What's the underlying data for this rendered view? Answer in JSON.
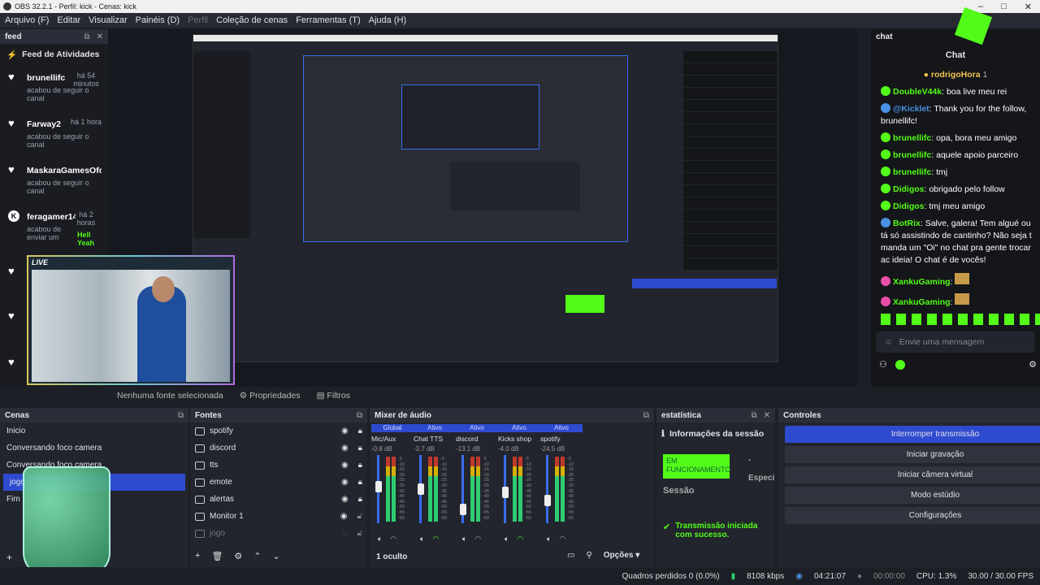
{
  "window": {
    "title": "OBS 32.2.1 - Perfil: kick - Cenas: kick"
  },
  "menu": [
    "Arquivo (F)",
    "Editar",
    "Visualizar",
    "Painéis (D)",
    "Perfil",
    "Coleção de cenas",
    "Ferramentas (T)",
    "Ajuda (H)"
  ],
  "feed": {
    "title": "feed",
    "heading": "Feed de Atividades",
    "items": [
      {
        "name": "brunellifc",
        "time": "há 54 minutos",
        "desc": "acabou de seguir o canal"
      },
      {
        "name": "Farway2",
        "time": "há 1 hora",
        "desc": "acabou de seguir o canal"
      },
      {
        "name": "MaskaraGamesOfc",
        "time": "",
        "desc": "acabou de seguir o canal"
      },
      {
        "name": "feragamer14",
        "time": "há 2 horas",
        "desc": "acabou de enviar um",
        "extra": "Hell Yeah"
      }
    ]
  },
  "overlay": {
    "live": "LIVE"
  },
  "chat": {
    "title": "chat",
    "heading": "Chat",
    "host": "rodrigoHora",
    "host_count": "1",
    "messages": [
      {
        "user": "DoubleV44k",
        "text": "boa live meu rei"
      },
      {
        "user": "@Kicklet",
        "text": "Thank you for the follow, brunellifc!"
      },
      {
        "user": "brunellifc",
        "text": "opa, bora meu amigo"
      },
      {
        "user": "brunellifc",
        "text": "aquele apoio parceiro"
      },
      {
        "user": "brunellifc",
        "text": "tmj"
      },
      {
        "user": "Didigos",
        "text": "obrigado pelo follow"
      },
      {
        "user": "Didigos",
        "text": "tmj meu amigo"
      },
      {
        "user": "BotRix",
        "text": "Salve, galera! Tem algué ou tá só assistindo de cantinho? Não seja t manda um \"Oi\" no chat pra gente trocar ac ideia! O chat é de vocês!"
      },
      {
        "user": "XankuGaming",
        "text": ""
      },
      {
        "user": "XankuGaming",
        "text": ""
      }
    ],
    "placeholder": "Envie uma mensagem"
  },
  "preview_bar": {
    "no_source": "Nenhuma fonte selecionada",
    "properties": "Propriedades",
    "filters": "Filtros"
  },
  "scenes": {
    "title": "Cenas",
    "items": [
      "Inicio",
      "Conversando foco camera",
      "Conversando foco camera",
      "jogo",
      "Fim"
    ],
    "selected": 3
  },
  "sources": {
    "title": "Fontes",
    "items": [
      "spotify",
      "discord",
      "tts",
      "emote",
      "alertas",
      "Monitor 1",
      "jogo"
    ]
  },
  "mixer": {
    "title": "Mixer de áudio",
    "hidden": "1 oculto",
    "options": "Opções",
    "channels": [
      {
        "hdr": "Global",
        "name": "Mic/Aux",
        "db": "-0.8 dB",
        "level": 0.55
      },
      {
        "hdr": "Ativo",
        "name": "Chat TTS",
        "db": "-3.7 dB",
        "level": 0.5
      },
      {
        "hdr": "Ativo",
        "name": "discord",
        "db": "-13.1 dB",
        "level": 0.15
      },
      {
        "hdr": "Ativo",
        "name": "Kicks shop",
        "db": "-4.0 dB",
        "level": 0.45
      },
      {
        "hdr": "Ativo",
        "name": "spotify",
        "db": "-24.5 dB",
        "level": 0.3
      }
    ],
    "scale": [
      "-5",
      "-10",
      "-15",
      "-20",
      "-25",
      "-30",
      "-35",
      "-40",
      "-45",
      "-50",
      "-55",
      "-60"
    ]
  },
  "stats": {
    "title": "estatística",
    "session_info": "Informações da sessão",
    "status": "EM FUNCIONAMENTO",
    "session": "Sessão",
    "spec": "Especi",
    "notice": "Transmissão iniciada com sucesso."
  },
  "controls": {
    "title": "Controles",
    "buttons": [
      "Interromper transmissão",
      "Iniciar gravação",
      "Iniciar câmera virtual",
      "Modo estúdio",
      "Configurações"
    ]
  },
  "status": {
    "frames": "Quadros perdidos 0 (0.0%)",
    "kbps": "8108 kbps",
    "live_time": "04:21:07",
    "rec_time": "00:00:00",
    "cpu": "CPU: 1.3%",
    "fps": "30.00 / 30.00 FPS"
  },
  "colors": {
    "accent": "#2e4bd0",
    "kick": "#53fc18"
  }
}
